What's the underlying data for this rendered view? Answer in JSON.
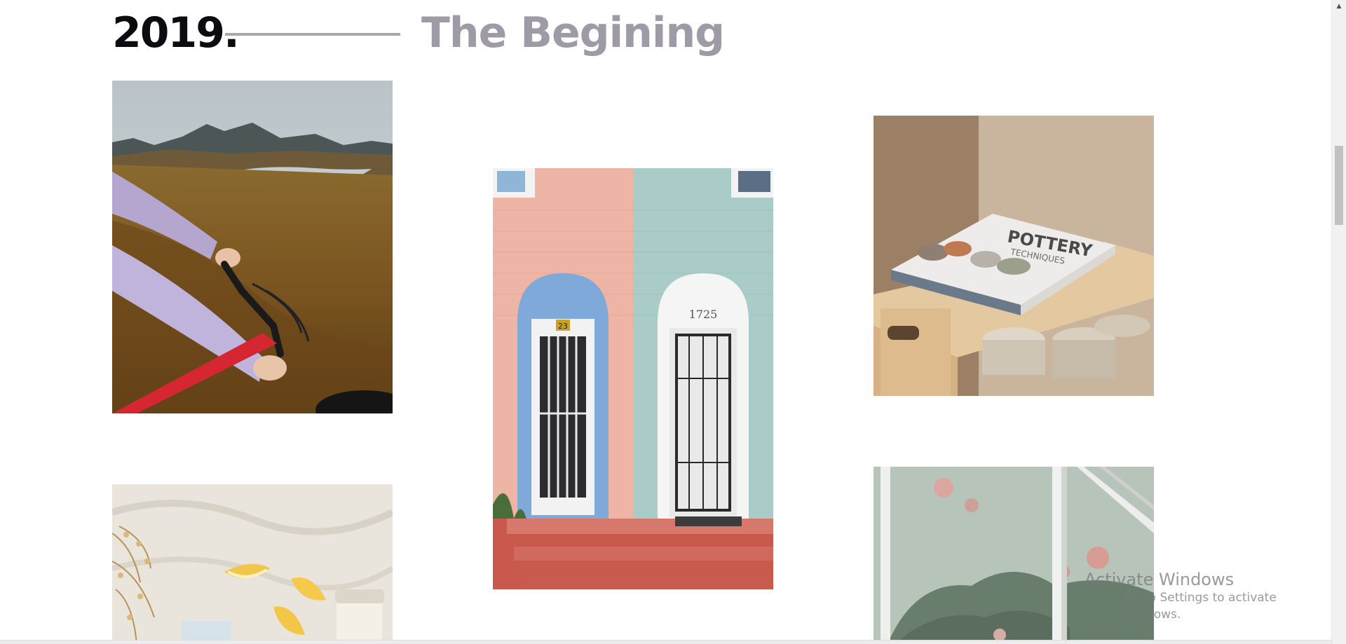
{
  "section": {
    "year": "2019.",
    "title": "The Begining"
  },
  "gallery": [
    {
      "name": "bike-mountain-photo",
      "subject": "cyclist on grassy hillside with mountains and lake"
    },
    {
      "name": "pastel-doors-photo",
      "subject": "pink and blue brick house fronts with doors",
      "house_number": "1725",
      "door_number": "23"
    },
    {
      "name": "pottery-book-photo",
      "subject": "pottery techniques book on wooden shelf with bowls",
      "book_title_line1": "POTTERY",
      "book_title_line2": "TECHNIQUES"
    },
    {
      "name": "lemons-blanket-photo",
      "subject": "lemon slices and dried flowers on linen"
    },
    {
      "name": "greenhouse-window-photo",
      "subject": "misty greenhouse window with flowers"
    }
  ],
  "windows_watermark": {
    "title": "Activate Windows",
    "subtitle": "Go to Settings to activate Windows."
  },
  "colors": {
    "year_text": "#0b0b10",
    "title_text": "#9e9ba6",
    "divider": "#a9a7b0"
  }
}
